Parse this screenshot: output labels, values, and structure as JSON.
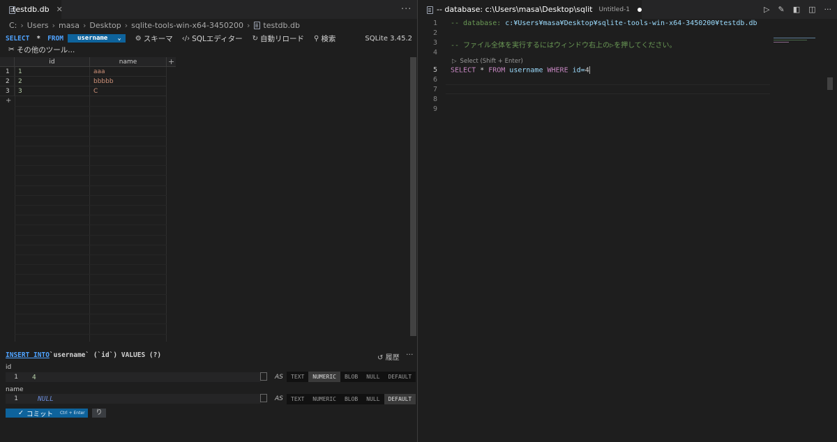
{
  "left": {
    "tab": {
      "label": "testdb.db",
      "close": "✕"
    },
    "more": "···",
    "breadcrumb": [
      "C:",
      "Users",
      "masa",
      "Desktop",
      "sqlite-tools-win-x64-3450200",
      "testdb.db"
    ],
    "toolbar": {
      "select": "SELECT",
      "star": "*",
      "from": "FROM",
      "table": "username",
      "schema": "スキーマ",
      "sql_editor": "SQLエディター",
      "auto_reload": "自動リロード",
      "search": "検索",
      "version": "SQLite 3.45.2",
      "other_tools": "その他のツール..."
    },
    "grid": {
      "columns": [
        "id",
        "name"
      ],
      "add_column": "+",
      "add_row": "+",
      "rows": [
        {
          "num": "1",
          "id": "1",
          "name": "aaa"
        },
        {
          "num": "2",
          "id": "2",
          "name": "bbbbb"
        },
        {
          "num": "3",
          "id": "3",
          "name": "C"
        }
      ]
    },
    "insert": {
      "kw": "INSERT INTO",
      "rest": "`username` (`id`) VALUES (?)",
      "history": "履歴",
      "more": "···",
      "fields": [
        {
          "label": "id",
          "num": "1",
          "value": "4",
          "as": "AS",
          "active": "NUMERIC"
        },
        {
          "label": "name",
          "num": "1",
          "value": "NULL",
          "as": "AS",
          "active": "DEFAULT"
        }
      ],
      "types": [
        "TEXT",
        "NUMERIC",
        "BLOB",
        "NULL",
        "DEFAULT"
      ],
      "commit": "コミット",
      "commit_hint": "Ctrl + Enter",
      "undo": "り"
    }
  },
  "right": {
    "tab": {
      "label": "-- database: c:\\Users\\masa\\Desktop\\sqlit",
      "untitled": "Untitled-1"
    },
    "codelens": "Select (Shift + Enter)",
    "lines": [
      {
        "n": "1",
        "comment": "-- database: ",
        "path": "c:¥Users¥masa¥Desktop¥sqlite-tools-win-x64-3450200¥testdb.db"
      },
      {
        "n": "2"
      },
      {
        "n": "3",
        "comment": "-- ファイル全体を実行するにはウィンドウ右上の▷を押してください。"
      },
      {
        "n": "4"
      },
      {
        "n": "5",
        "k1": "SELECT",
        "star": " * ",
        "k2": "FROM",
        "tbl": " username ",
        "k3": "WHERE",
        "cond": " id=",
        "cursor": "4"
      },
      {
        "n": "6"
      },
      {
        "n": "7"
      },
      {
        "n": "8"
      },
      {
        "n": "9"
      }
    ]
  }
}
